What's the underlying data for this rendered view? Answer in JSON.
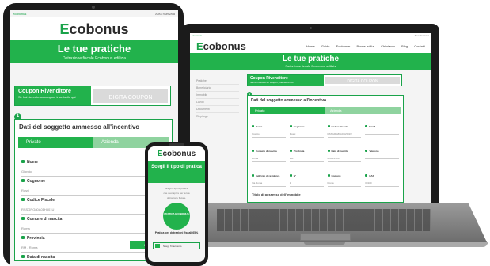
{
  "brand": {
    "logo_initial": "E",
    "logo_rest": "cobonus",
    "accent_color": "#22b24c"
  },
  "topbar": {
    "left": "ecobonus",
    "right": "Area riservata"
  },
  "header": {
    "title": "Le tue pratiche",
    "subtitle": "Detrazione fiscale Ecobonus edilizia"
  },
  "laptop": {
    "nav": [
      "Home",
      "Guide",
      "Ecobonus",
      "Bonus edilizi",
      "Chi siamo",
      "Blog",
      "Contatti"
    ],
    "sidebar": [
      "Pratiche",
      "Beneficiario",
      "Immobile",
      "Lavori",
      "Documenti",
      "Riepilogo"
    ],
    "grid_fields": [
      {
        "label": "Nome",
        "value": "Giorgio"
      },
      {
        "label": "Cognome",
        "value": "Rossi"
      },
      {
        "label": "Codice Fiscale",
        "value": "RSSGRG80A01H501U"
      },
      {
        "label": "Email",
        "value": ""
      },
      {
        "label": "Comune di nascita",
        "value": "Roma"
      },
      {
        "label": "Provincia",
        "value": "RM"
      },
      {
        "label": "Data di nascita",
        "value": "01/01/1980"
      },
      {
        "label": "Telefono",
        "value": ""
      },
      {
        "label": "Indirizzo di residenza",
        "value": "Via Roma"
      },
      {
        "label": "N°",
        "value": "1"
      },
      {
        "label": "Comune",
        "value": "Roma"
      },
      {
        "label": "CAP",
        "value": "00100"
      }
    ],
    "section2": "Titolo di possesso dell'immobile"
  },
  "coupon": {
    "title": "Coupon Rivenditore",
    "subtitle": "Se hai ricevuto un coupon, inseriscilo qui",
    "cta": "DIGITA COUPON"
  },
  "section": {
    "step": "1",
    "title": "Dati del soggetto ammesso all'incentivo",
    "tab_active": "Privato",
    "tab_inactive": "Azienda"
  },
  "tablet": {
    "fields": [
      {
        "label": "Nome",
        "value": "Giorgio"
      },
      {
        "label": "Cognome",
        "value": "Rossi"
      },
      {
        "label": "Codice Fiscale",
        "value": "RSSGRG80A01H501U"
      },
      {
        "label": "Comune di nascita",
        "value": "Roma"
      },
      {
        "label": "Provincia",
        "value": "RM - Roma"
      },
      {
        "label": "Data di nascita",
        "value": ""
      }
    ],
    "button": "Procedi"
  },
  "phone": {
    "title": "Scegli il tipo di pratica",
    "body": [
      "Scegli il tipo di pratica",
      "che vuoi aprire per la tua",
      "detrazione fiscale."
    ],
    "circle": "PRATICA ECOBONUS",
    "pro": "Pratica per detrazioni fiscali 65%",
    "select": "Scegli l'intervento"
  }
}
